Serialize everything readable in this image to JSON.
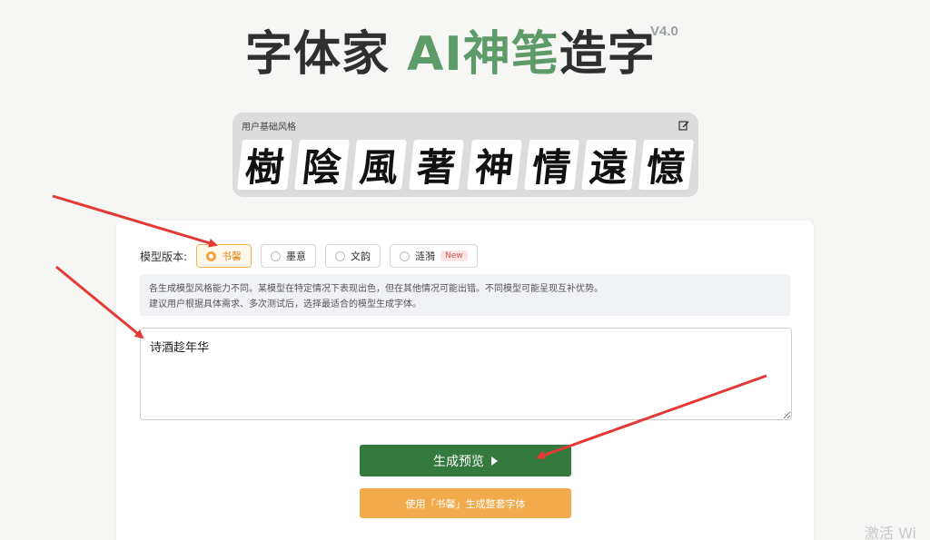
{
  "header": {
    "title_part1": "字体家 ",
    "title_accent": "AI神笔",
    "title_part2": "造字",
    "version": "V4.0"
  },
  "base_style": {
    "label": "用户基础风格",
    "glyphs": [
      "樹",
      "陰",
      "風",
      "著",
      "神",
      "情",
      "遠",
      "憶"
    ]
  },
  "model": {
    "label": "模型版本:",
    "options": [
      {
        "label": "书馨",
        "selected": true
      },
      {
        "label": "墨意",
        "selected": false
      },
      {
        "label": "文韵",
        "selected": false
      },
      {
        "label": "涟漪",
        "selected": false,
        "badge": "New"
      }
    ]
  },
  "note": {
    "line1": "各生成模型风格能力不同。某模型在特定情况下表现出色，但在其他情况可能出错。不同模型可能呈现互补优势。",
    "line2": "建议用户根据具体需求、多次测试后，选择最适合的模型生成字体。"
  },
  "input": {
    "value": "诗酒趁年华"
  },
  "buttons": {
    "preview": "生成预览",
    "full": "使用「书馨」生成整套字体"
  },
  "watermark": "激活 Wi",
  "colors": {
    "accent_green": "#5d9b68",
    "primary_button": "#347a3f",
    "secondary_button": "#f1ab4c",
    "selected_option": "#f0a640",
    "annotation_arrow": "#e53935"
  }
}
